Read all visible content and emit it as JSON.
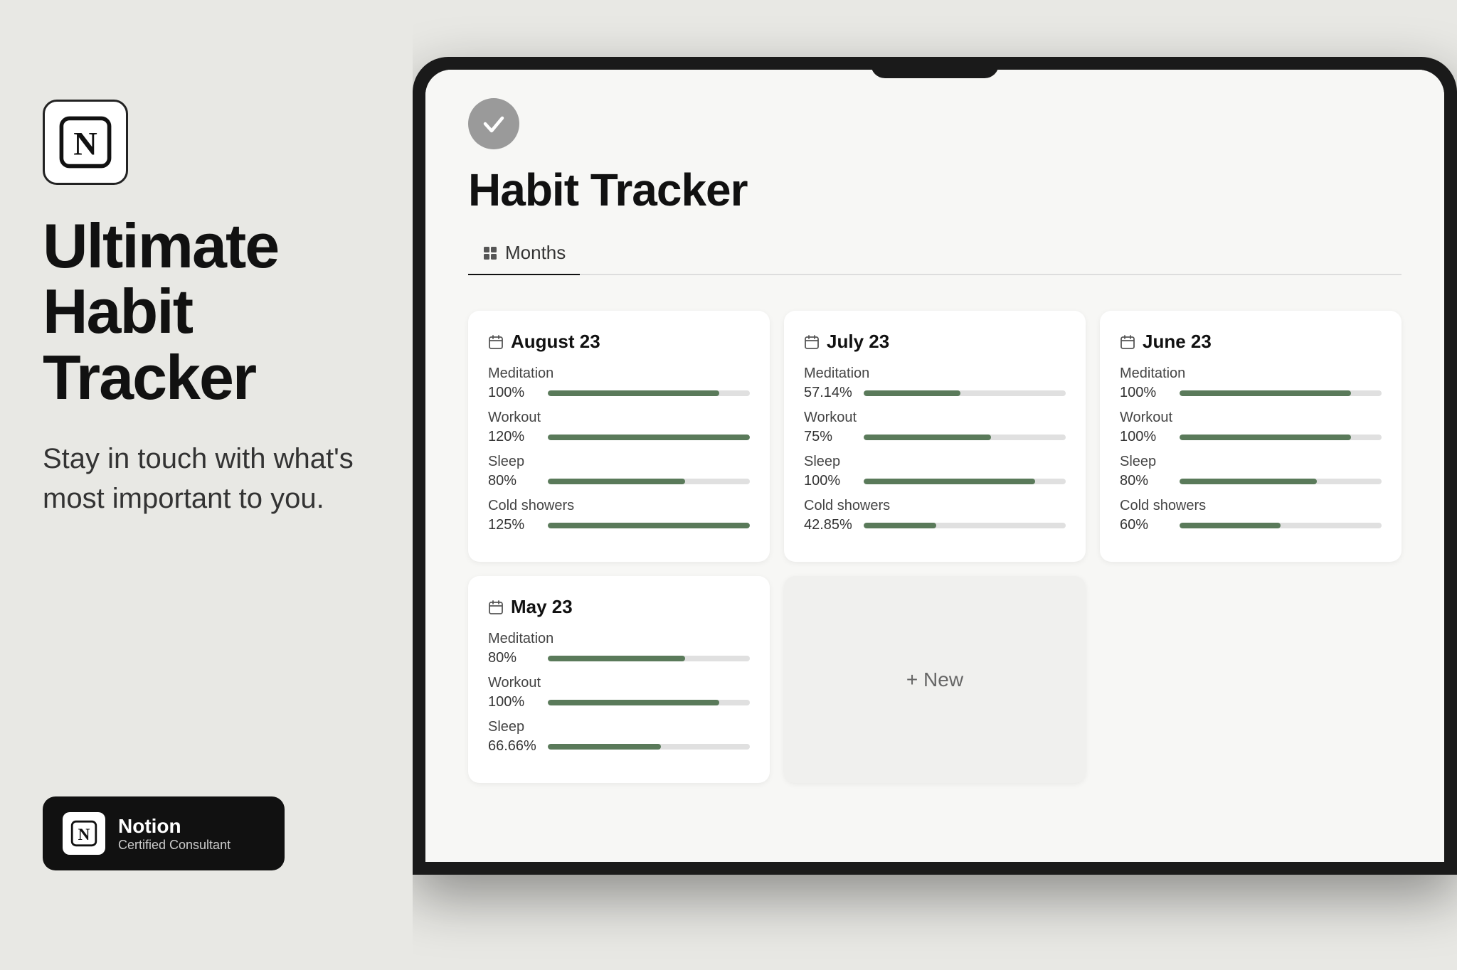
{
  "left": {
    "headline": "Ultimate\nHabit Tracker",
    "subtitle": "Stay in touch with what's most important to you.",
    "badge": {
      "notion_label": "Notion",
      "certified_label": "Certified Consultant"
    }
  },
  "notion": {
    "title": "Habit Tracker",
    "tab_label": "Months",
    "cards": [
      {
        "month": "August 23",
        "habits": [
          {
            "name": "Meditation",
            "pct": "100%",
            "fill": 85
          },
          {
            "name": "Workout",
            "pct": "120%",
            "fill": 100
          },
          {
            "name": "Sleep",
            "pct": "80%",
            "fill": 68
          },
          {
            "name": "Cold showers",
            "pct": "125%",
            "fill": 100
          }
        ]
      },
      {
        "month": "July 23",
        "habits": [
          {
            "name": "Meditation",
            "pct": "57.14%",
            "fill": 48
          },
          {
            "name": "Workout",
            "pct": "75%",
            "fill": 63
          },
          {
            "name": "Sleep",
            "pct": "100%",
            "fill": 85
          },
          {
            "name": "Cold showers",
            "pct": "42.85%",
            "fill": 36
          }
        ]
      },
      {
        "month": "June 23",
        "habits": [
          {
            "name": "Meditation",
            "pct": "100%",
            "fill": 85
          },
          {
            "name": "Workout",
            "pct": "100%",
            "fill": 85
          },
          {
            "name": "Sleep",
            "pct": "80%",
            "fill": 68
          },
          {
            "name": "Cold showers",
            "pct": "60%",
            "fill": 50
          }
        ]
      },
      {
        "month": "May 23",
        "habits": [
          {
            "name": "Meditation",
            "pct": "80%",
            "fill": 68
          },
          {
            "name": "Workout",
            "pct": "100%",
            "fill": 85
          },
          {
            "name": "Sleep",
            "pct": "66.66%",
            "fill": 56
          }
        ]
      },
      {
        "month": "New",
        "is_new": true,
        "new_label": "+ New"
      }
    ]
  }
}
